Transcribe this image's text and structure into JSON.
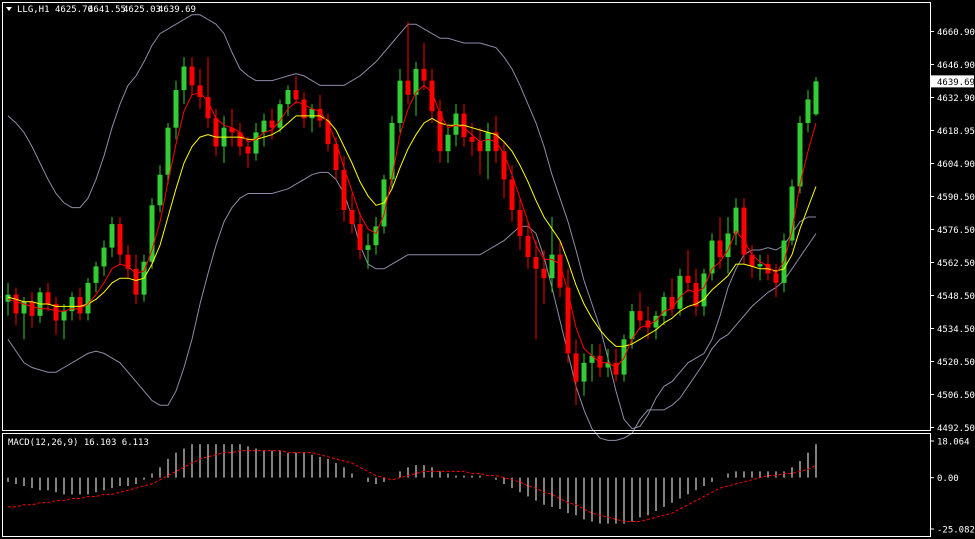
{
  "header": {
    "symbol": "LLG,H1",
    "open": "4625.70",
    "high": "4641.55",
    "low": "4625.03",
    "close": "4639.69"
  },
  "macd_label": "MACD(12,26,9) 16.103 6.113",
  "colors": {
    "background": "#000000",
    "bull": "#32CD32",
    "bear": "#FF0000",
    "ma_fast": "#FF0000",
    "ma_slow": "#FFFF00",
    "bands": "#8C8CA8",
    "grid_border": "#FFFFFF",
    "text": "#FFFFFF",
    "signal": "#FF0000",
    "histogram": "#FFFFFF"
  },
  "chart_data": [
    {
      "type": "candlestick",
      "yticks": [
        "4660.90",
        "4646.90",
        "4632.90",
        "4618.95",
        "4604.90",
        "4590.50",
        "4576.50",
        "4562.50",
        "4548.50",
        "4534.50",
        "4520.50",
        "4506.50",
        "4492.50"
      ],
      "ylim": [
        4492.5,
        4668.0
      ],
      "current_price": "4639.69",
      "candles": [
        [
          4546,
          4554,
          4540,
          4549
        ],
        [
          4549,
          4552,
          4536,
          4541
        ],
        [
          4541,
          4548,
          4530,
          4546
        ],
        [
          4546,
          4550,
          4535,
          4540
        ],
        [
          4540,
          4552,
          4537,
          4550
        ],
        [
          4550,
          4554,
          4542,
          4545
        ],
        [
          4545,
          4548,
          4532,
          4538
        ],
        [
          4538,
          4545,
          4530,
          4542
        ],
        [
          4542,
          4550,
          4538,
          4548
        ],
        [
          4548,
          4552,
          4538,
          4541
        ],
        [
          4541,
          4556,
          4538,
          4554
        ],
        [
          4554,
          4563,
          4550,
          4561
        ],
        [
          4561,
          4572,
          4557,
          4569
        ],
        [
          4569,
          4582,
          4565,
          4579
        ],
        [
          4579,
          4582,
          4562,
          4566
        ],
        [
          4566,
          4570,
          4556,
          4560
        ],
        [
          4560,
          4566,
          4545,
          4549
        ],
        [
          4549,
          4566,
          4546,
          4563
        ],
        [
          4563,
          4590,
          4560,
          4587
        ],
        [
          4587,
          4604,
          4584,
          4600
        ],
        [
          4600,
          4622,
          4596,
          4620
        ],
        [
          4620,
          4640,
          4615,
          4636
        ],
        [
          4636,
          4650,
          4630,
          4646
        ],
        [
          4646,
          4650,
          4634,
          4638
        ],
        [
          4638,
          4645,
          4628,
          4633
        ],
        [
          4633,
          4650,
          4620,
          4624
        ],
        [
          4624,
          4628,
          4608,
          4612
        ],
        [
          4612,
          4625,
          4605,
          4620
        ],
        [
          4620,
          4628,
          4612,
          4618
        ],
        [
          4618,
          4622,
          4608,
          4612
        ],
        [
          4612,
          4616,
          4603,
          4609
        ],
        [
          4609,
          4622,
          4606,
          4618
        ],
        [
          4618,
          4626,
          4612,
          4623
        ],
        [
          4623,
          4628,
          4615,
          4620
        ],
        [
          4620,
          4632,
          4618,
          4630
        ],
        [
          4630,
          4638,
          4625,
          4636
        ],
        [
          4636,
          4642,
          4630,
          4632
        ],
        [
          4632,
          4635,
          4620,
          4624
        ],
        [
          4624,
          4630,
          4618,
          4628
        ],
        [
          4628,
          4634,
          4620,
          4623
        ],
        [
          4623,
          4626,
          4610,
          4613
        ],
        [
          4613,
          4616,
          4598,
          4602
        ],
        [
          4602,
          4608,
          4580,
          4585
        ],
        [
          4585,
          4592,
          4575,
          4579
        ],
        [
          4579,
          4584,
          4564,
          4568
        ],
        [
          4568,
          4575,
          4560,
          4570
        ],
        [
          4570,
          4582,
          4566,
          4578
        ],
        [
          4578,
          4600,
          4575,
          4598
        ],
        [
          4598,
          4625,
          4594,
          4622
        ],
        [
          4622,
          4645,
          4618,
          4640
        ],
        [
          4640,
          4665,
          4630,
          4634
        ],
        [
          4634,
          4648,
          4625,
          4645
        ],
        [
          4645,
          4656,
          4636,
          4640
        ],
        [
          4640,
          4645,
          4622,
          4627
        ],
        [
          4627,
          4632,
          4605,
          4610
        ],
        [
          4610,
          4620,
          4605,
          4617
        ],
        [
          4617,
          4630,
          4612,
          4626
        ],
        [
          4626,
          4630,
          4612,
          4616
        ],
        [
          4616,
          4622,
          4608,
          4614
        ],
        [
          4614,
          4620,
          4600,
          4610
        ],
        [
          4610,
          4622,
          4598,
          4618
        ],
        [
          4618,
          4625,
          4605,
          4610
        ],
        [
          4610,
          4614,
          4590,
          4598
        ],
        [
          4598,
          4604,
          4580,
          4585
        ],
        [
          4585,
          4590,
          4568,
          4574
        ],
        [
          4574,
          4580,
          4560,
          4565
        ],
        [
          4565,
          4572,
          4530,
          4560
        ],
        [
          4560,
          4568,
          4545,
          4556
        ],
        [
          4556,
          4582,
          4550,
          4566
        ],
        [
          4566,
          4572,
          4548,
          4552
        ],
        [
          4552,
          4560,
          4520,
          4524
        ],
        [
          4524,
          4530,
          4502,
          4512
        ],
        [
          4512,
          4524,
          4506,
          4520
        ],
        [
          4520,
          4528,
          4512,
          4523
        ],
        [
          4523,
          4528,
          4514,
          4518
        ],
        [
          4518,
          4526,
          4514,
          4520
        ],
        [
          4520,
          4526,
          4512,
          4515
        ],
        [
          4515,
          4532,
          4512,
          4530
        ],
        [
          4530,
          4545,
          4526,
          4542
        ],
        [
          4542,
          4550,
          4534,
          4538
        ],
        [
          4538,
          4544,
          4530,
          4535
        ],
        [
          4535,
          4542,
          4530,
          4540
        ],
        [
          4540,
          4550,
          4536,
          4548
        ],
        [
          4548,
          4556,
          4540,
          4543
        ],
        [
          4543,
          4560,
          4540,
          4557
        ],
        [
          4557,
          4568,
          4550,
          4554
        ],
        [
          4554,
          4560,
          4540,
          4544
        ],
        [
          4544,
          4560,
          4540,
          4558
        ],
        [
          4558,
          4575,
          4555,
          4572
        ],
        [
          4572,
          4582,
          4560,
          4565
        ],
        [
          4565,
          4582,
          4558,
          4575
        ],
        [
          4575,
          4590,
          4570,
          4586
        ],
        [
          4586,
          4590,
          4562,
          4566
        ],
        [
          4566,
          4570,
          4556,
          4561
        ],
        [
          4561,
          4566,
          4555,
          4562
        ],
        [
          4562,
          4566,
          4555,
          4558
        ],
        [
          4558,
          4562,
          4548,
          4554
        ],
        [
          4554,
          4575,
          4550,
          4572
        ],
        [
          4572,
          4598,
          4570,
          4595
        ],
        [
          4595,
          4625,
          4592,
          4622
        ],
        [
          4622,
          4636,
          4618,
          4632
        ],
        [
          4625.7,
          4641.55,
          4625.03,
          4639.69
        ]
      ],
      "ma_fast": [
        4547,
        4546,
        4545,
        4544,
        4543,
        4543,
        4542,
        4542,
        4543,
        4543,
        4545,
        4549,
        4554,
        4560,
        4562,
        4561,
        4558,
        4559,
        4568,
        4580,
        4597,
        4613,
        4627,
        4634,
        4635,
        4631,
        4624,
        4621,
        4620,
        4618,
        4614,
        4615,
        4618,
        4619,
        4623,
        4628,
        4631,
        4630,
        4628,
        4627,
        4622,
        4614,
        4603,
        4593,
        4583,
        4577,
        4575,
        4583,
        4599,
        4617,
        4628,
        4635,
        4638,
        4635,
        4626,
        4620,
        4621,
        4620,
        4617,
        4614,
        4615,
        4614,
        4609,
        4600,
        4590,
        4580,
        4570,
        4564,
        4564,
        4562,
        4550,
        4535,
        4526,
        4523,
        4520,
        4520,
        4518,
        4522,
        4530,
        4535,
        4536,
        4538,
        4542,
        4543,
        4548,
        4551,
        4550,
        4552,
        4560,
        4563,
        4568,
        4576,
        4572,
        4566,
        4563,
        4561,
        4558,
        4563,
        4576,
        4596,
        4610,
        4622
      ],
      "ma_slow": [
        4548,
        4547,
        4546,
        4546,
        4545,
        4545,
        4544,
        4544,
        4544,
        4544,
        4545,
        4547,
        4550,
        4554,
        4556,
        4556,
        4555,
        4556,
        4562,
        4570,
        4582,
        4594,
        4605,
        4612,
        4616,
        4617,
        4616,
        4616,
        4616,
        4616,
        4615,
        4615,
        4616,
        4617,
        4619,
        4622,
        4625,
        4625,
        4625,
        4625,
        4623,
        4619,
        4612,
        4605,
        4597,
        4591,
        4587,
        4588,
        4594,
        4603,
        4611,
        4617,
        4622,
        4624,
        4622,
        4621,
        4621,
        4621,
        4620,
        4619,
        4618,
        4617,
        4614,
        4610,
        4604,
        4597,
        4589,
        4582,
        4577,
        4572,
        4563,
        4553,
        4545,
        4539,
        4534,
        4530,
        4527,
        4527,
        4528,
        4530,
        4532,
        4534,
        4537,
        4539,
        4542,
        4544,
        4545,
        4547,
        4551,
        4554,
        4557,
        4562,
        4562,
        4561,
        4560,
        4560,
        4559,
        4560,
        4566,
        4577,
        4586,
        4595
      ],
      "bb_upper": [
        4625,
        4622,
        4618,
        4612,
        4605,
        4598,
        4592,
        4588,
        4586,
        4586,
        4590,
        4598,
        4608,
        4620,
        4630,
        4638,
        4642,
        4648,
        4655,
        4660,
        4662,
        4664,
        4666,
        4668,
        4668,
        4666,
        4664,
        4660,
        4652,
        4645,
        4642,
        4640,
        4640,
        4640,
        4641,
        4642,
        4643,
        4642,
        4640,
        4638,
        4638,
        4638,
        4638,
        4640,
        4642,
        4645,
        4648,
        4652,
        4656,
        4660,
        4664,
        4664,
        4662,
        4660,
        4658,
        4658,
        4657,
        4656,
        4656,
        4656,
        4655,
        4654,
        4650,
        4645,
        4638,
        4630,
        4622,
        4612,
        4600,
        4590,
        4580,
        4568,
        4555,
        4545,
        4535,
        4522,
        4508,
        4496,
        4492,
        4493,
        4498,
        4505,
        4510,
        4512,
        4516,
        4520,
        4522,
        4524,
        4530,
        4540,
        4552,
        4560,
        4566,
        4568,
        4568,
        4569,
        4568,
        4570,
        4575,
        4580,
        4582,
        4582
      ],
      "bb_lower": [
        4530,
        4525,
        4520,
        4518,
        4517,
        4516,
        4516,
        4518,
        4520,
        4522,
        4524,
        4525,
        4524,
        4522,
        4520,
        4516,
        4512,
        4508,
        4504,
        4502,
        4502,
        4508,
        4518,
        4530,
        4545,
        4558,
        4570,
        4580,
        4586,
        4590,
        4592,
        4592,
        4592,
        4592,
        4593,
        4594,
        4596,
        4598,
        4600,
        4601,
        4601,
        4598,
        4592,
        4582,
        4570,
        4562,
        4560,
        4560,
        4562,
        4564,
        4566,
        4566,
        4566,
        4566,
        4566,
        4566,
        4566,
        4566,
        4566,
        4566,
        4568,
        4570,
        4572,
        4575,
        4578,
        4578,
        4575,
        4565,
        4552,
        4538,
        4524,
        4510,
        4500,
        4492,
        4488,
        4487,
        4487,
        4488,
        4490,
        4496,
        4500,
        4500,
        4500,
        4502,
        4505,
        4510,
        4515,
        4520,
        4526,
        4530,
        4532,
        4536,
        4540,
        4544,
        4547,
        4550,
        4552,
        4555,
        4560,
        4565,
        4570,
        4575
      ]
    },
    {
      "type": "macd",
      "yticks": [
        "18.064",
        "0.00",
        "-25.082"
      ],
      "ylim": [
        -25.082,
        18.064
      ],
      "histogram": [
        -2,
        -3,
        -4,
        -5,
        -6,
        -6,
        -7,
        -8,
        -8,
        -8,
        -8,
        -7,
        -6,
        -5,
        -4,
        -4,
        -3,
        -1,
        2,
        5,
        9,
        12,
        14,
        16,
        16,
        16,
        16,
        16,
        16,
        16,
        15,
        14,
        13,
        13,
        13,
        12,
        12,
        12,
        11,
        10,
        9,
        7,
        5,
        2,
        0,
        -2,
        -3,
        -2,
        0,
        3,
        5,
        6,
        6,
        5,
        3,
        2,
        1,
        1,
        1,
        1,
        0,
        -1,
        -3,
        -5,
        -7,
        -9,
        -11,
        -13,
        -14,
        -15,
        -17,
        -18,
        -20,
        -21,
        -22,
        -22,
        -22,
        -22,
        -21,
        -19,
        -18,
        -16,
        -14,
        -12,
        -10,
        -8,
        -6,
        -4,
        -2,
        0,
        2,
        3,
        3,
        3,
        3,
        3,
        3,
        3,
        5,
        8,
        12,
        16
      ],
      "signal": [
        -14,
        -14,
        -13,
        -13,
        -12,
        -12,
        -11,
        -11,
        -10,
        -10,
        -9,
        -9,
        -8,
        -8,
        -7,
        -6,
        -5,
        -4,
        -3,
        -1,
        1,
        3,
        5,
        7,
        9,
        10,
        11,
        12,
        12,
        13,
        13,
        13,
        13,
        13,
        13,
        12,
        12,
        12,
        12,
        11,
        10,
        9,
        8,
        7,
        5,
        3,
        1,
        0,
        -1,
        0,
        1,
        2,
        3,
        3,
        3,
        3,
        3,
        3,
        2,
        2,
        1,
        1,
        0,
        -1,
        -2,
        -4,
        -5,
        -7,
        -8,
        -10,
        -12,
        -13,
        -15,
        -17,
        -18,
        -19,
        -20,
        -21,
        -21,
        -21,
        -20,
        -19,
        -18,
        -17,
        -15,
        -13,
        -11,
        -9,
        -7,
        -5,
        -4,
        -3,
        -2,
        -1,
        0,
        1,
        1,
        2,
        2,
        3,
        4,
        6
      ]
    }
  ]
}
